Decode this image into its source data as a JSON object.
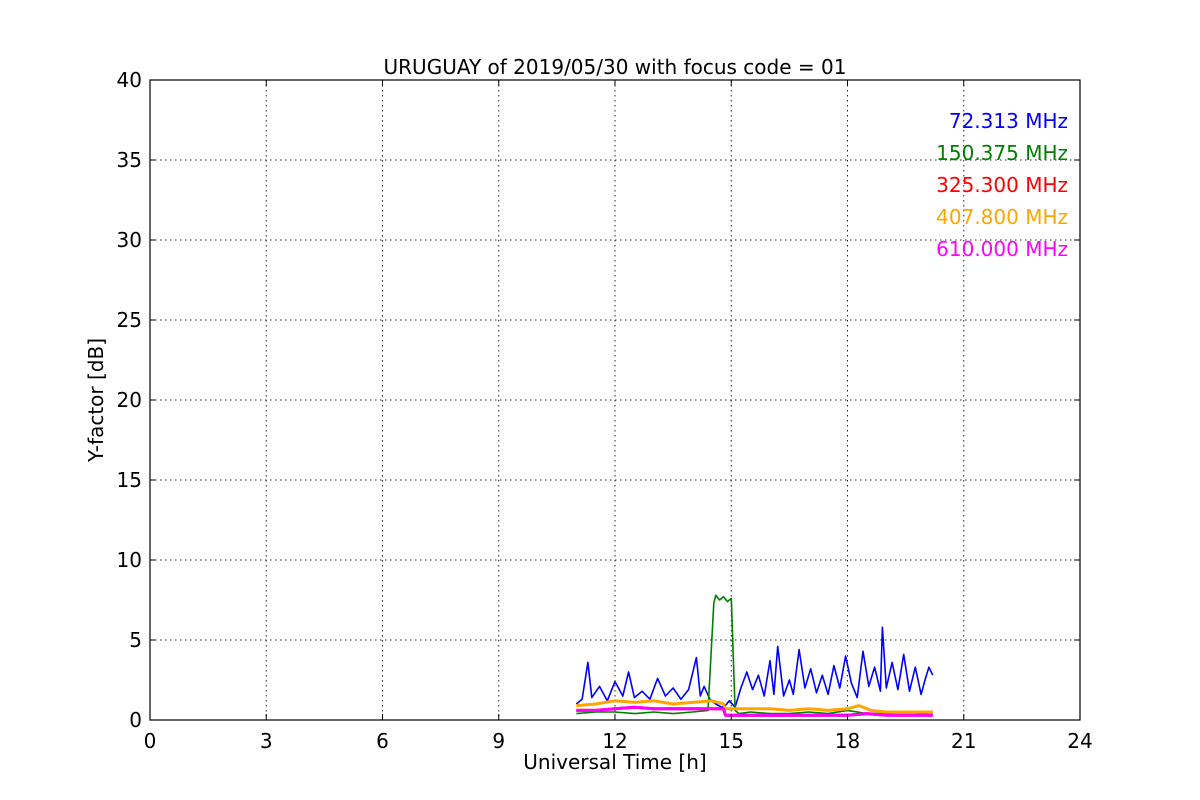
{
  "chart_data": {
    "type": "line",
    "title": "URUGUAY of 2019/05/30 with focus code = 01",
    "xlabel": "Universal Time [h]",
    "ylabel": "Y-factor [dB]",
    "xlim": [
      0,
      24
    ],
    "ylim": [
      0,
      40
    ],
    "xticks": [
      0,
      3,
      6,
      9,
      12,
      15,
      18,
      21,
      24
    ],
    "yticks": [
      0,
      5,
      10,
      15,
      20,
      25,
      30,
      35,
      40
    ],
    "grid": true,
    "legend_position": "top-right",
    "series": [
      {
        "name": "72.313 MHz",
        "color": "#0000ff",
        "x": [
          11.0,
          11.15,
          11.3,
          11.4,
          11.6,
          11.8,
          12.0,
          12.2,
          12.35,
          12.5,
          12.7,
          12.9,
          13.1,
          13.3,
          13.5,
          13.7,
          13.9,
          14.1,
          14.2,
          14.3,
          14.45,
          14.6,
          14.75,
          14.85,
          14.95,
          15.1,
          15.25,
          15.4,
          15.55,
          15.7,
          15.85,
          16.0,
          16.1,
          16.2,
          16.35,
          16.5,
          16.6,
          16.75,
          16.9,
          17.05,
          17.2,
          17.35,
          17.5,
          17.65,
          17.8,
          17.95,
          18.1,
          18.25,
          18.4,
          18.55,
          18.7,
          18.85,
          18.9,
          19.0,
          19.15,
          19.3,
          19.45,
          19.6,
          19.75,
          19.9,
          20.0,
          20.1,
          20.2
        ],
        "y": [
          1.0,
          1.3,
          3.6,
          1.4,
          2.1,
          1.2,
          2.4,
          1.5,
          3.0,
          1.4,
          1.8,
          1.3,
          2.6,
          1.5,
          2.0,
          1.3,
          1.9,
          3.9,
          1.5,
          2.1,
          1.3,
          1.0,
          0.8,
          0.9,
          1.2,
          0.8,
          2.0,
          3.0,
          1.9,
          2.8,
          1.5,
          3.7,
          1.6,
          4.6,
          1.5,
          2.5,
          1.6,
          4.4,
          2.0,
          3.2,
          1.7,
          2.8,
          1.6,
          3.4,
          2.0,
          4.0,
          2.3,
          1.4,
          4.3,
          2.1,
          3.3,
          1.8,
          5.8,
          2.0,
          3.6,
          1.9,
          4.1,
          1.8,
          3.3,
          1.6,
          2.5,
          3.3,
          2.8
        ]
      },
      {
        "name": "150.375 MHz",
        "color": "#008000",
        "x": [
          11.0,
          11.5,
          12.0,
          12.5,
          13.0,
          13.5,
          14.0,
          14.4,
          14.55,
          14.6,
          14.7,
          14.8,
          14.9,
          15.0,
          15.1,
          15.2,
          15.5,
          16.0,
          16.5,
          17.0,
          17.5,
          18.0,
          18.5,
          19.0,
          19.5,
          20.0,
          20.2
        ],
        "y": [
          0.4,
          0.5,
          0.5,
          0.4,
          0.5,
          0.4,
          0.5,
          0.6,
          7.3,
          7.8,
          7.5,
          7.7,
          7.4,
          7.6,
          0.6,
          0.4,
          0.5,
          0.4,
          0.4,
          0.5,
          0.4,
          0.6,
          0.4,
          0.4,
          0.5,
          0.4,
          0.5
        ]
      },
      {
        "name": "325.300 MHz",
        "color": "#ff0000",
        "x": [
          11.0,
          11.5,
          12.0,
          12.5,
          13.0,
          13.5,
          14.0,
          14.5,
          14.8,
          14.85,
          15.5,
          16.0,
          16.5,
          17.0,
          17.5,
          18.0,
          18.5,
          19.0,
          19.5,
          20.0,
          20.2
        ],
        "y": [
          0.6,
          0.6,
          0.7,
          0.8,
          0.7,
          0.7,
          0.7,
          0.7,
          0.7,
          0.3,
          0.3,
          0.3,
          0.3,
          0.3,
          0.3,
          0.3,
          0.4,
          0.3,
          0.3,
          0.3,
          0.3
        ]
      },
      {
        "name": "407.800 MHz",
        "color": "#ffa500",
        "x": [
          11.0,
          11.5,
          12.0,
          12.5,
          13.0,
          13.5,
          14.0,
          14.5,
          14.8,
          14.85,
          15.5,
          16.0,
          16.5,
          17.0,
          17.5,
          18.0,
          18.3,
          18.6,
          19.0,
          19.5,
          20.0,
          20.2
        ],
        "y": [
          0.9,
          1.0,
          1.2,
          1.1,
          1.2,
          1.0,
          1.1,
          1.2,
          1.0,
          0.7,
          0.7,
          0.7,
          0.6,
          0.7,
          0.6,
          0.7,
          0.9,
          0.6,
          0.5,
          0.5,
          0.5,
          0.5
        ]
      },
      {
        "name": "610.000 MHz",
        "color": "#ff00ff",
        "x": [
          11.0,
          11.5,
          12.0,
          12.5,
          13.0,
          13.5,
          14.0,
          14.5,
          14.8,
          14.85,
          15.5,
          16.0,
          16.5,
          17.0,
          17.5,
          18.0,
          18.5,
          19.0,
          19.5,
          20.0,
          20.2
        ],
        "y": [
          0.6,
          0.6,
          0.7,
          0.8,
          0.7,
          0.7,
          0.7,
          0.7,
          0.7,
          0.3,
          0.3,
          0.3,
          0.3,
          0.3,
          0.3,
          0.3,
          0.4,
          0.3,
          0.3,
          0.3,
          0.3
        ]
      }
    ]
  }
}
